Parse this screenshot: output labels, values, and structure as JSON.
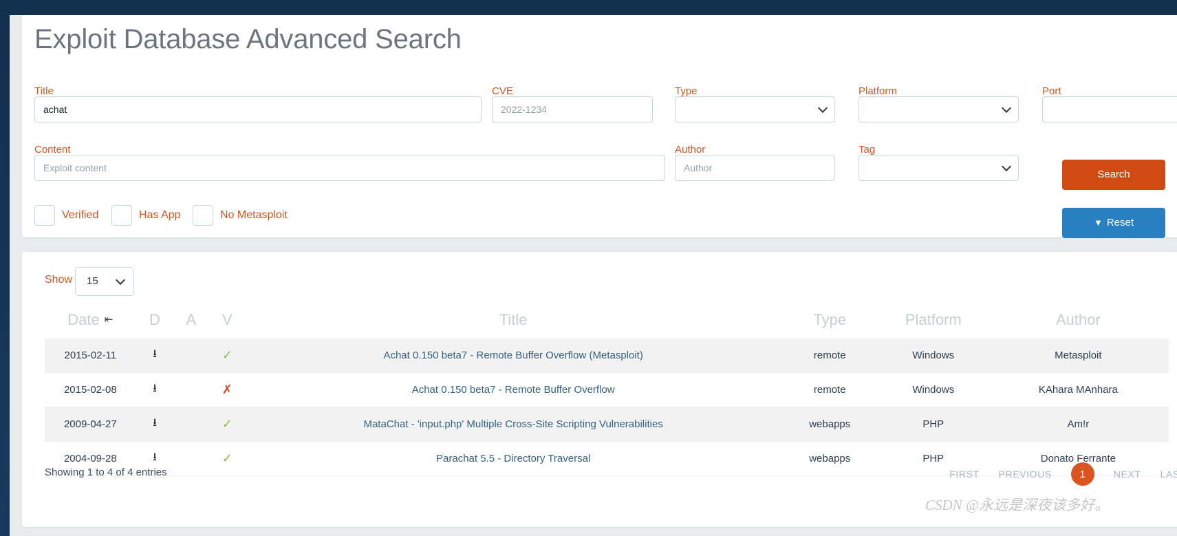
{
  "page": {
    "title": "Exploit Database Advanced Search"
  },
  "search_form": {
    "fields": [
      {
        "label": "Title",
        "value": "achat",
        "placeholder": "",
        "kind": "text"
      },
      {
        "label": "CVE",
        "value": "",
        "placeholder": "2022-1234",
        "kind": "text"
      },
      {
        "label": "Type",
        "value": "",
        "placeholder": "",
        "kind": "select"
      },
      {
        "label": "Platform",
        "value": "",
        "placeholder": "",
        "kind": "select"
      },
      {
        "label": "Port",
        "value": "",
        "placeholder": "",
        "kind": "text"
      },
      {
        "label": "Content",
        "value": "",
        "placeholder": "Exploit content",
        "kind": "text"
      },
      {
        "label": "Author",
        "value": "",
        "placeholder": "Author",
        "kind": "text"
      },
      {
        "label": "Tag",
        "value": "",
        "placeholder": "",
        "kind": "select"
      }
    ],
    "checkboxes": [
      {
        "label": "Verified",
        "checked": false
      },
      {
        "label": "Has App",
        "checked": false
      },
      {
        "label": "No Metasploit",
        "checked": false
      }
    ],
    "buttons": {
      "search": "Search",
      "reset": "Reset",
      "reset_icon": "filter-remove-icon"
    }
  },
  "results": {
    "show_label": "Show",
    "show_value": "15",
    "columns": [
      "Date",
      "D",
      "A",
      "V",
      "Title",
      "Type",
      "Platform",
      "Author"
    ],
    "sort_column": "Date",
    "sort_icon": "sort-descending-icon",
    "rows": [
      {
        "date": "2015-02-11",
        "download": "download-icon",
        "app": "",
        "verified": "check-icon",
        "title": "Achat 0.150 beta7 - Remote Buffer Overflow (Metasploit)",
        "type": "remote",
        "platform": "Windows",
        "author": "Metasploit"
      },
      {
        "date": "2015-02-08",
        "download": "download-icon",
        "app": "",
        "verified": "cross-icon",
        "title": "Achat 0.150 beta7 - Remote Buffer Overflow",
        "type": "remote",
        "platform": "Windows",
        "author": "KAhara MAnhara"
      },
      {
        "date": "2009-04-27",
        "download": "download-icon",
        "app": "",
        "verified": "check-icon",
        "title": "MataChat - 'input.php' Multiple Cross-Site Scripting Vulnerabilities",
        "type": "webapps",
        "platform": "PHP",
        "author": "Am!r"
      },
      {
        "date": "2004-09-28",
        "download": "download-icon",
        "app": "",
        "verified": "check-icon",
        "title": "Parachat 5.5 - Directory Traversal",
        "type": "webapps",
        "platform": "PHP",
        "author": "Donato Ferrante"
      }
    ],
    "showing_entries": "Showing 1 to 4 of 4 entries",
    "pagination": {
      "first": "FIRST",
      "previous": "PREVIOUS",
      "current_page": "1",
      "next": "NEXT",
      "last": "LAST"
    }
  },
  "watermark": {
    "text": "CSDN @永远是深夜该多好。"
  },
  "colors": {
    "accent_orange": "#d9541e",
    "search_button": "#cf4b12",
    "reset_button": "#2a7fc0",
    "header_dark": "#12314f",
    "link_blue": "#34617f",
    "check_green": "#8bbf4d",
    "cross_red": "#d9441f"
  }
}
